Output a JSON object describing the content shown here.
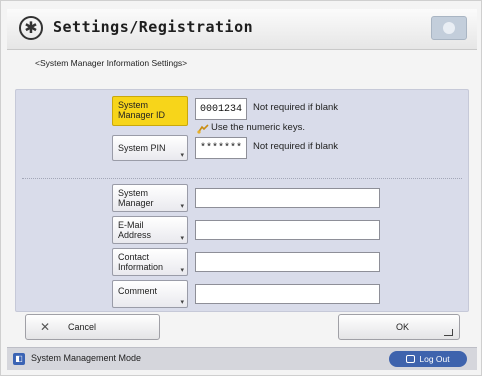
{
  "header": {
    "title": "Settings/Registration",
    "settings_icon": "settings-icon",
    "help_icon": "help-icon"
  },
  "subtitle": "<System Manager Information Settings>",
  "form": {
    "manager_id": {
      "label_line1": "System",
      "label_line2": "Manager ID",
      "value": "0001234",
      "hint": "Not required if blank",
      "keys_hint": "Use the numeric keys."
    },
    "system_pin": {
      "label": "System PIN",
      "value": "*******",
      "hint": "Not required if blank"
    },
    "system_manager": {
      "label_line1": "System",
      "label_line2": "Manager",
      "value": ""
    },
    "email": {
      "label_line1": "E-Mail",
      "label_line2": "Address",
      "value": ""
    },
    "contact": {
      "label_line1": "Contact",
      "label_line2": "Information",
      "value": ""
    },
    "comment": {
      "label": "Comment",
      "value": ""
    }
  },
  "buttons": {
    "cancel": "Cancel",
    "ok": "OK"
  },
  "status_bar": {
    "mode": "System Management Mode",
    "logout": "Log Out"
  },
  "colors": {
    "accent_yellow": "#f7d51a",
    "panel": "#d9dcea",
    "logout_blue": "#3e63ad"
  }
}
